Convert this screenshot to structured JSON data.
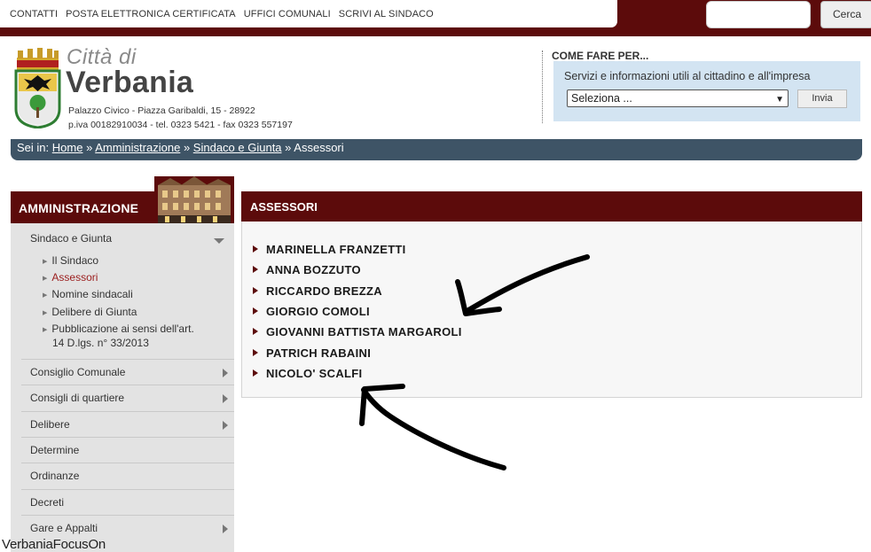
{
  "top_links": [
    "CONTATTI",
    "POSTA ELETTRONICA CERTIFICATA",
    "UFFICI COMUNALI",
    "SCRIVI AL SINDACO"
  ],
  "search": {
    "button_label": "Cerca",
    "value": ""
  },
  "site": {
    "city_prefix": "Città di",
    "city_name": "Verbania",
    "address_line1": "Palazzo Civico - Piazza Garibaldi, 15 - 28922",
    "address_line2": "p.iva 00182910034 - tel. 0323 5421 - fax 0323 557197"
  },
  "howto": {
    "title": "COME FARE PER...",
    "description": "Servizi e informazioni utili al cittadino e all'impresa",
    "select_value": "Seleziona ...",
    "button_label": "Invia"
  },
  "breadcrumb": {
    "prefix": "Sei in:",
    "items": [
      "Home",
      "Amministrazione",
      "Sindaco e Giunta"
    ],
    "separator": "»",
    "current": "Assessori"
  },
  "sidebar": {
    "title": "AMMINISTRAZIONE",
    "open_section": "Sindaco e Giunta",
    "subitems": [
      "Il Sindaco",
      "Assessori",
      "Nomine sindacali",
      "Delibere di Giunta",
      "Pubblicazione ai sensi dell'art.",
      "14 D.lgs. n° 33/2013"
    ],
    "active_subitem": "Assessori",
    "sections": [
      "Consiglio Comunale",
      "Consigli di quartiere",
      "Delibere",
      "Determine",
      "Ordinanze",
      "Decreti",
      "Gare e Appalti"
    ]
  },
  "main": {
    "title": "ASSESSORI",
    "assessori": [
      "MARINELLA FRANZETTI",
      "ANNA BOZZUTO",
      "RICCARDO BREZZA",
      "GIORGIO COMOLI",
      "GIOVANNI BATTISTA MARGAROLI",
      "PATRICH RABAINI",
      "NICOLO' SCALFI"
    ]
  },
  "watermark": "VerbaniaFocusOn",
  "colors": {
    "brand": "#5c0b0b",
    "breadcrumb_bg": "#3e5466",
    "howto_bg": "#d3e4f2",
    "active_link": "#9b1d1d"
  }
}
